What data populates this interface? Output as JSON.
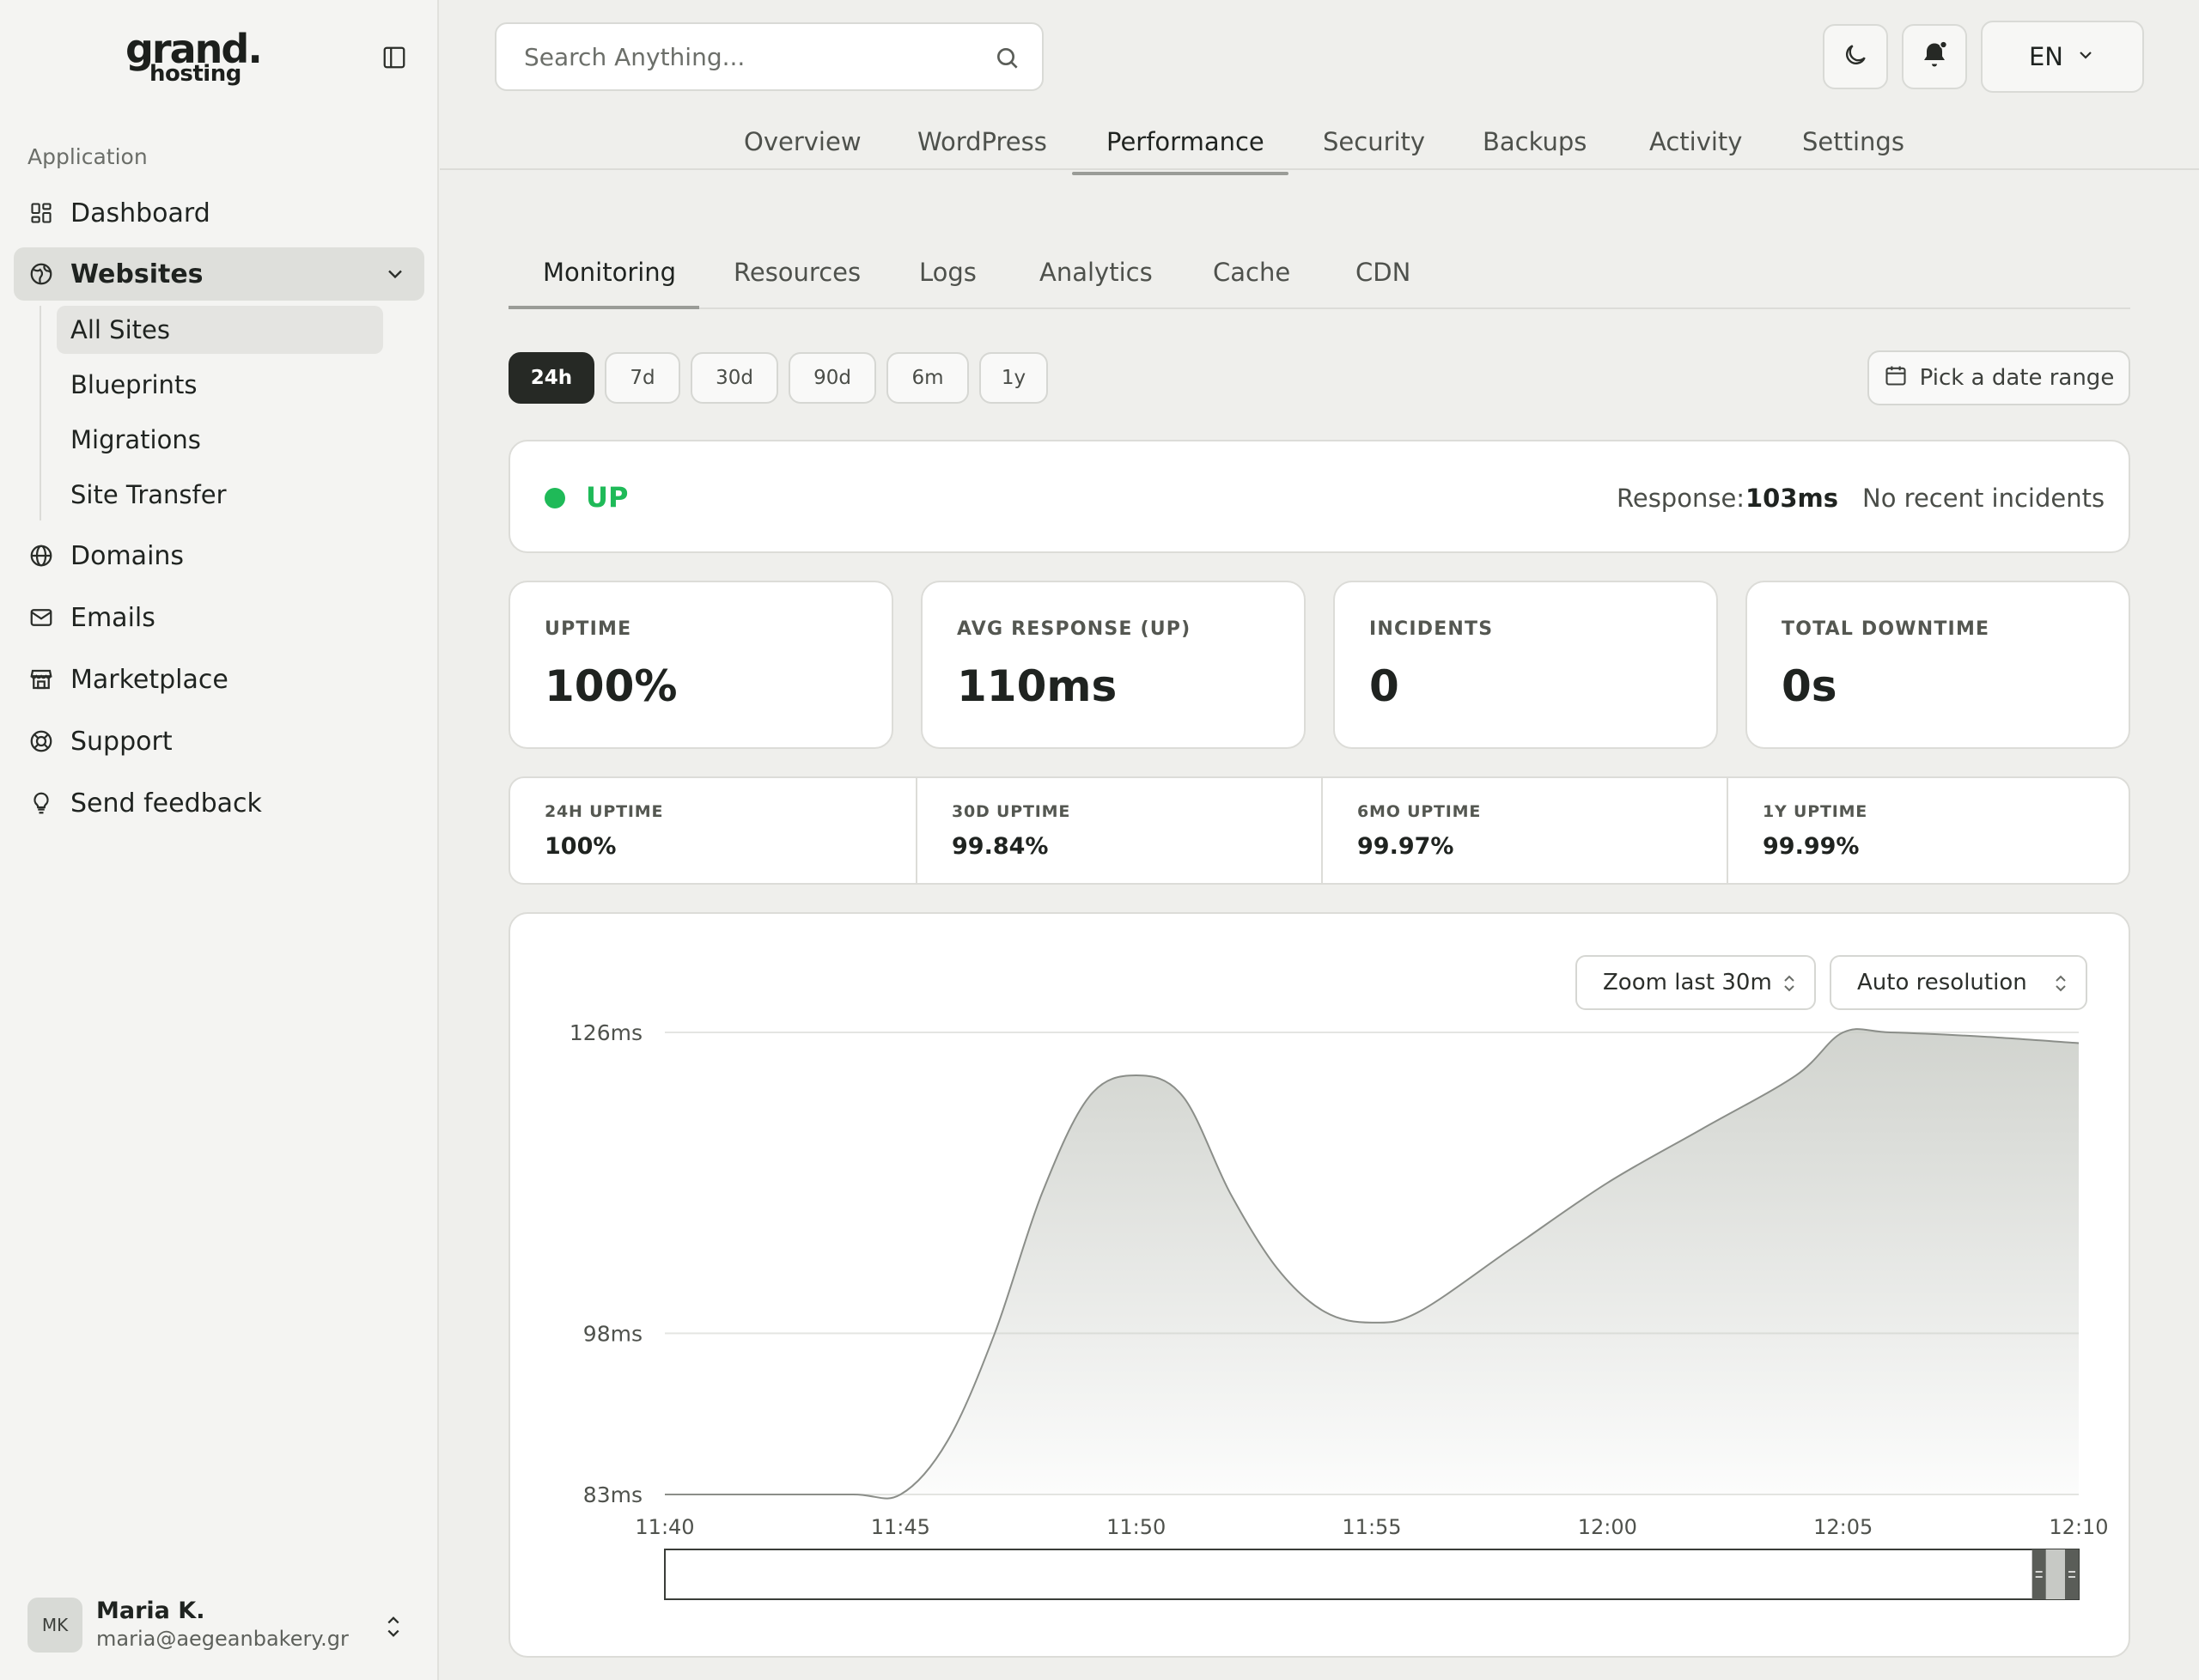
{
  "brand": {
    "logo_line1": "grand.",
    "logo_line2": "hosting"
  },
  "sidebar": {
    "section_label": "Application",
    "items": [
      {
        "label": "Dashboard",
        "icon": "dashboard-icon"
      },
      {
        "label": "Websites",
        "icon": "websites-icon",
        "active": true
      },
      {
        "label": "Domains",
        "icon": "globe-icon"
      },
      {
        "label": "Emails",
        "icon": "mail-icon"
      },
      {
        "label": "Marketplace",
        "icon": "store-icon"
      },
      {
        "label": "Support",
        "icon": "lifebuoy-icon"
      },
      {
        "label": "Send feedback",
        "icon": "lightbulb-icon"
      }
    ],
    "sub_items": [
      {
        "label": "All Sites",
        "active": true
      },
      {
        "label": "Blueprints"
      },
      {
        "label": "Migrations"
      },
      {
        "label": "Site Transfer"
      }
    ],
    "user": {
      "initials": "MK",
      "name": "Maria K.",
      "email": "maria@aegeanbakery.gr"
    }
  },
  "topbar": {
    "search_placeholder": "Search Anything...",
    "language": "EN"
  },
  "main_tabs": [
    "Overview",
    "WordPress",
    "Performance",
    "Security",
    "Backups",
    "Activity",
    "Settings"
  ],
  "active_main_tab": "Performance",
  "sub_tabs": [
    "Monitoring",
    "Resources",
    "Logs",
    "Analytics",
    "Cache",
    "CDN"
  ],
  "active_sub_tab": "Monitoring",
  "ranges": [
    "24h",
    "7d",
    "30d",
    "90d",
    "6m",
    "1y"
  ],
  "active_range": "24h",
  "date_range_label": "Pick a date range",
  "status": {
    "state": "UP",
    "response_label": "Response:",
    "response_value": "103ms",
    "incidents_note": "No recent incidents",
    "color": "#1fba58"
  },
  "stats": [
    {
      "label": "UPTIME",
      "value": "100%"
    },
    {
      "label": "AVG RESPONSE (UP)",
      "value": "110ms"
    },
    {
      "label": "INCIDENTS",
      "value": "0"
    },
    {
      "label": "TOTAL DOWNTIME",
      "value": "0s"
    }
  ],
  "uptimes": [
    {
      "label": "24H UPTIME",
      "value": "100%"
    },
    {
      "label": "30D UPTIME",
      "value": "99.84%"
    },
    {
      "label": "6MO UPTIME",
      "value": "99.97%"
    },
    {
      "label": "1Y UPTIME",
      "value": "99.99%"
    }
  ],
  "chart_controls": {
    "zoom": "Zoom last 30m",
    "resolution": "Auto resolution"
  },
  "chart_data": {
    "type": "area",
    "x": [
      "11:40",
      "11:42",
      "11:44",
      "11:45",
      "11:46",
      "11:47",
      "11:48",
      "11:49",
      "11:50",
      "11:51",
      "11:52",
      "11:53",
      "11:54",
      "11:55",
      "11:56",
      "11:58",
      "12:00",
      "12:02",
      "12:04",
      "12:05",
      "12:06",
      "12:08",
      "12:10"
    ],
    "values": [
      83,
      83,
      83,
      83,
      88,
      98,
      111,
      120,
      122,
      120,
      111,
      104,
      100,
      99,
      100,
      106,
      112,
      117,
      122,
      126,
      126,
      125.6,
      125
    ],
    "x_ticks": [
      "11:40",
      "11:45",
      "11:50",
      "11:55",
      "12:00",
      "12:05",
      "12:10"
    ],
    "y_ticks": [
      "126ms",
      "98ms",
      "83ms"
    ],
    "y_tick_values": [
      126,
      98,
      83
    ],
    "ylim": [
      83,
      126
    ],
    "grid": true,
    "line_color": "#8b8e89",
    "fill_color": "#c9ccc6",
    "brush_range": [
      0.967,
      1.0
    ]
  }
}
